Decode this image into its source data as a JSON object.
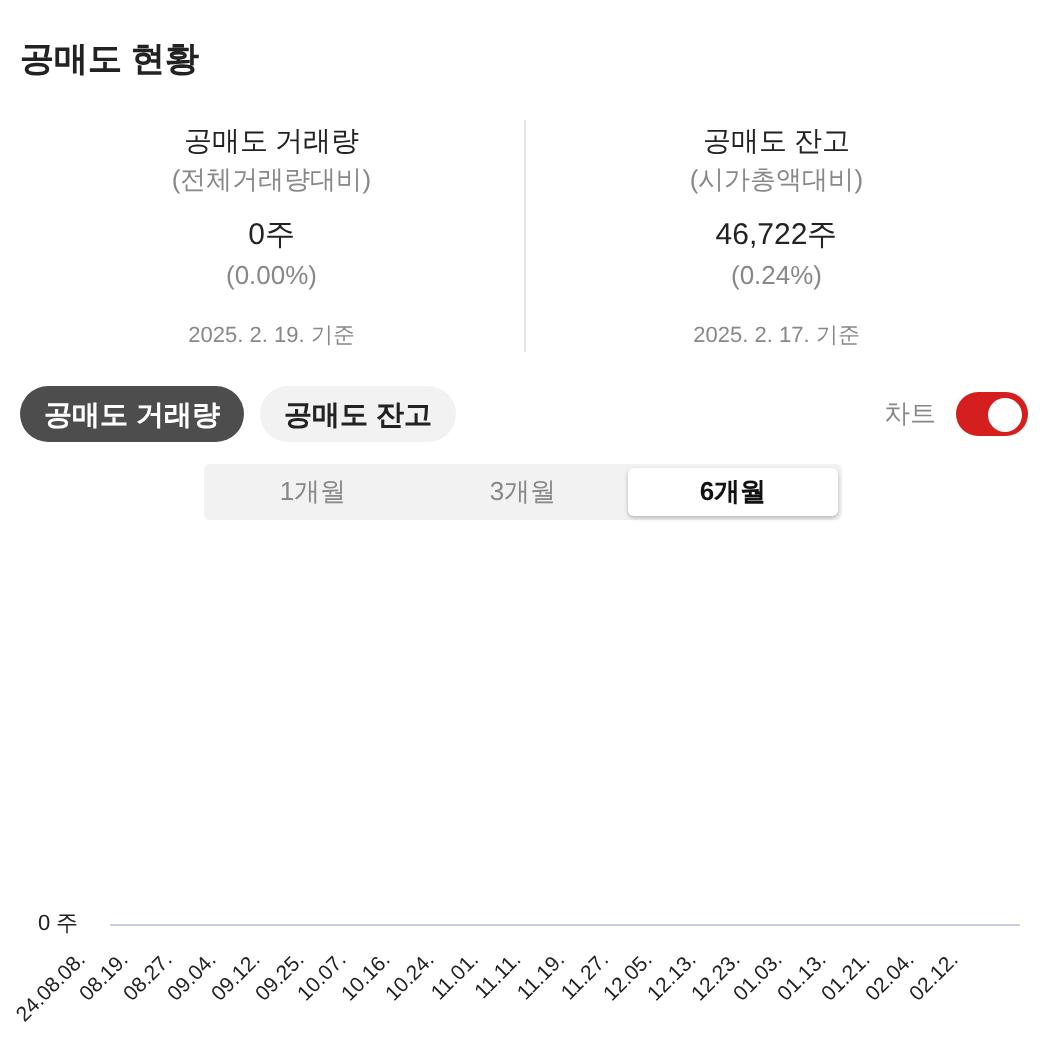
{
  "title": "공매도 현황",
  "stats": [
    {
      "label": "공매도 거래량",
      "sublabel": "(전체거래량대비)",
      "value": "0주",
      "percent": "(0.00%)",
      "date": "2025. 2. 19. 기준"
    },
    {
      "label": "공매도 잔고",
      "sublabel": "(시가총액대비)",
      "value": "46,722주",
      "percent": "(0.24%)",
      "date": "2025. 2. 17. 기준"
    }
  ],
  "tabs": [
    {
      "label": "공매도 거래량",
      "selected": true
    },
    {
      "label": "공매도 잔고",
      "selected": false
    }
  ],
  "chart_toggle": {
    "label": "차트",
    "on": true
  },
  "periods": [
    {
      "label": "1개월",
      "selected": false
    },
    {
      "label": "3개월",
      "selected": false
    },
    {
      "label": "6개월",
      "selected": true
    }
  ],
  "chart": {
    "y_tick": "0 주",
    "x_labels": [
      "24.08.08.",
      "08.19.",
      "08.27.",
      "09.04.",
      "09.12.",
      "09.25.",
      "10.07.",
      "10.16.",
      "10.24.",
      "11.01.",
      "11.11.",
      "11.19.",
      "11.27.",
      "12.05.",
      "12.13.",
      "12.23.",
      "01.03.",
      "01.13.",
      "01.21.",
      "02.04.",
      "02.12."
    ]
  }
}
